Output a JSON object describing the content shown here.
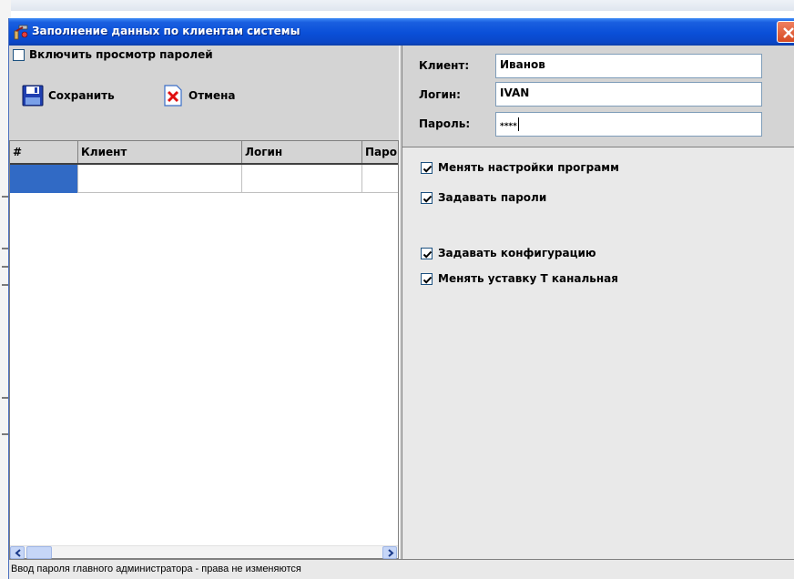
{
  "window": {
    "title": "Заполнение данных по клиентам системы"
  },
  "left_panel": {
    "show_passwords": {
      "label": "Включить просмотр паролей",
      "checked": false
    },
    "toolbar": {
      "save_label": "Сохранить",
      "cancel_label": "Отмена"
    },
    "grid": {
      "columns": [
        "#",
        "Клиент",
        "Логин",
        "Паро"
      ],
      "rows": [
        [
          "",
          "",
          "",
          ""
        ]
      ]
    }
  },
  "right_panel": {
    "client": {
      "label": "Клиент:",
      "value": "Иванов"
    },
    "login": {
      "label": "Логин:",
      "value": "IVAN"
    },
    "password": {
      "label": "Пароль:",
      "value": "****"
    },
    "permissions": [
      {
        "label": "Менять настройки программ",
        "checked": true
      },
      {
        "label": "Задавать пароли",
        "checked": true
      },
      {
        "label": "Задавать конфигурацию",
        "checked": true
      },
      {
        "label": "Менять уставку Т канальная",
        "checked": true
      }
    ]
  },
  "status": {
    "text": "Ввод пароля главного администратора - права не изменяются"
  },
  "icons": {
    "app": "app-tool-icon",
    "close": "close-icon",
    "save": "floppy-disk-icon",
    "cancel": "red-x-icon",
    "scroll_left": "arrow-left-icon",
    "scroll_right": "arrow-right-icon"
  },
  "colors": {
    "titlebar": "#0a4fd8",
    "selection": "#316ac5",
    "close_button": "#d64a22"
  }
}
